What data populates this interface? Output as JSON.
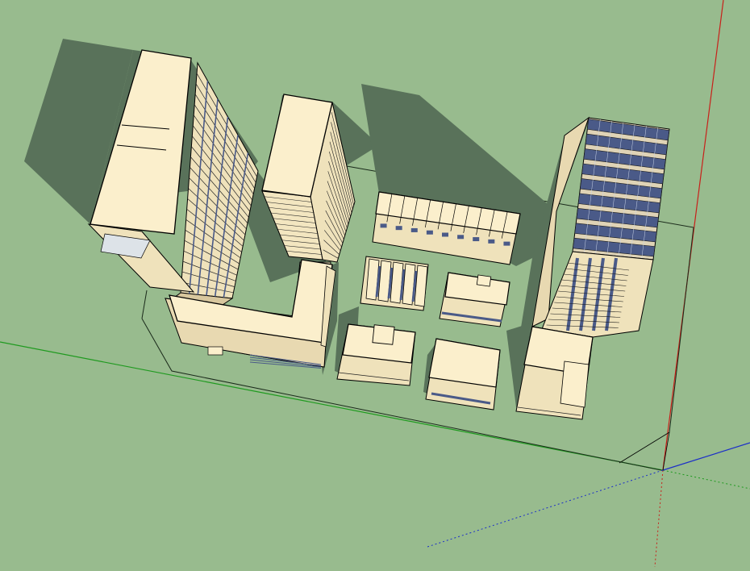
{
  "viewport": {
    "title": "",
    "background_color": "#98bb8e",
    "shadow_color": "#59725a",
    "facade_color": "#fbefcc",
    "facade_side_color": "#efe2bb",
    "glass_color": "#4a5a88",
    "edge_color": "#000000"
  },
  "axes": {
    "red": "#c8201a",
    "green": "#1f9a1f",
    "blue": "#1c2fc8"
  },
  "scene": {
    "buildings": [
      "tall-tower-west",
      "slab-tower-north",
      "podium-wing",
      "long-low-block",
      "small-block-ribbed",
      "small-block-right",
      "small-block-front-left",
      "small-block-front-right",
      "glass-tower-east",
      "tower-east-podium"
    ]
  }
}
